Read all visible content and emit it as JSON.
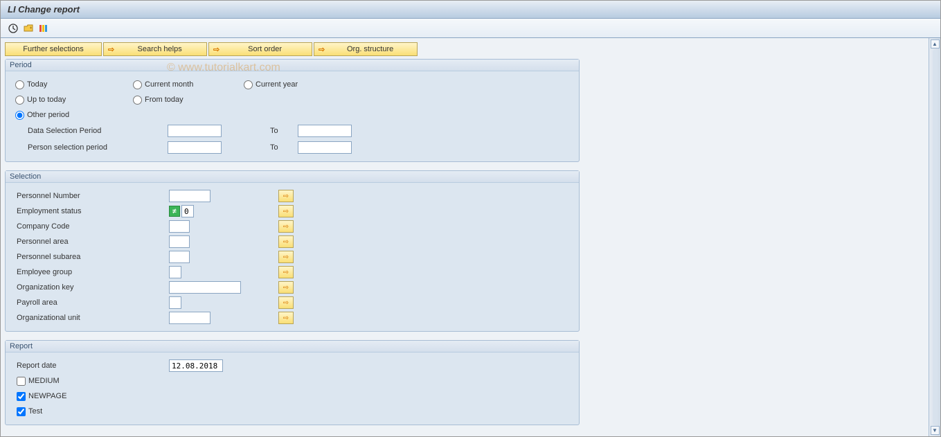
{
  "title": "LI Change report",
  "watermark": "© www.tutorialkart.com",
  "actionButtons": {
    "further": "Further selections",
    "search": "Search helps",
    "sort": "Sort order",
    "org": "Org. structure"
  },
  "groups": {
    "period": {
      "title": "Period",
      "radios": {
        "today": "Today",
        "currentMonth": "Current month",
        "currentYear": "Current year",
        "upToToday": "Up to today",
        "fromToday": "From today",
        "otherPeriod": "Other period"
      },
      "dataSelection": {
        "label": "Data Selection Period",
        "from": "",
        "toLabel": "To",
        "to": ""
      },
      "personSelection": {
        "label": "Person selection period",
        "from": "",
        "toLabel": "To",
        "to": ""
      }
    },
    "selection": {
      "title": "Selection",
      "fields": {
        "personnelNumber": {
          "label": "Personnel Number",
          "value": ""
        },
        "employmentStatus": {
          "label": "Employment status",
          "value": "0"
        },
        "companyCode": {
          "label": "Company Code",
          "value": ""
        },
        "personnelArea": {
          "label": "Personnel area",
          "value": ""
        },
        "personnelSubarea": {
          "label": "Personnel subarea",
          "value": ""
        },
        "employeeGroup": {
          "label": "Employee group",
          "value": ""
        },
        "organizationKey": {
          "label": "Organization key",
          "value": ""
        },
        "payrollArea": {
          "label": "Payroll area",
          "value": ""
        },
        "organizationalUnit": {
          "label": "Organizational unit",
          "value": ""
        }
      }
    },
    "report": {
      "title": "Report",
      "reportDate": {
        "label": "Report date",
        "value": "12.08.2018"
      },
      "checks": {
        "medium": {
          "label": "MEDIUM",
          "checked": false
        },
        "newpage": {
          "label": "NEWPAGE",
          "checked": true
        },
        "test": {
          "label": "Test",
          "checked": true
        }
      }
    }
  }
}
